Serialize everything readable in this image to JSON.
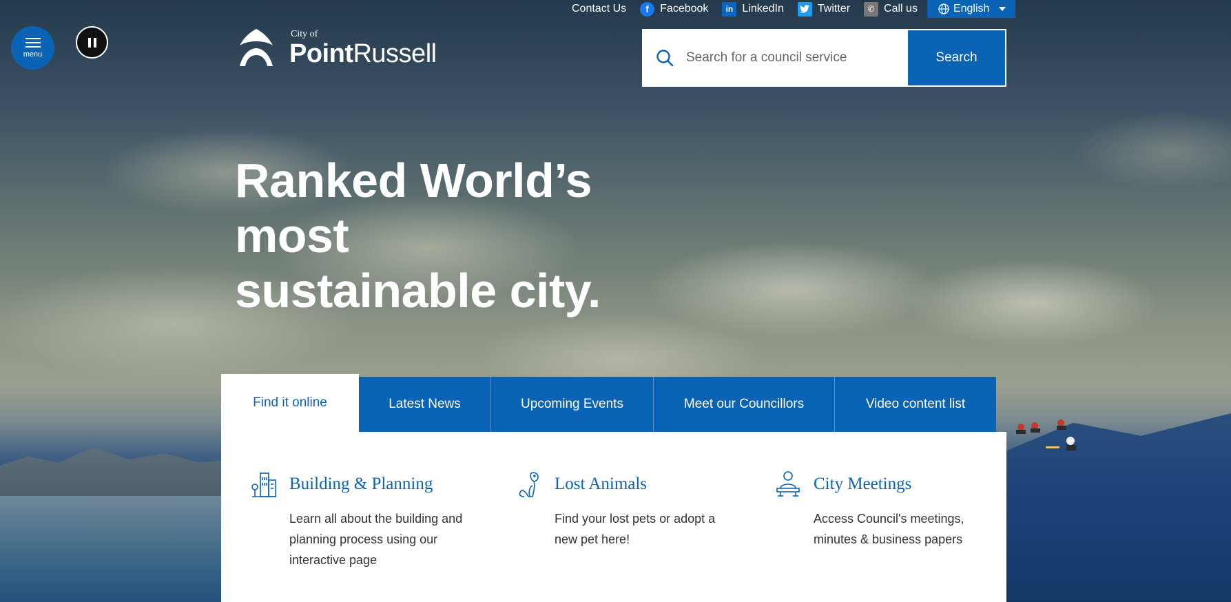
{
  "topbar": {
    "contact": "Contact Us",
    "facebook": "Facebook",
    "linkedin": "LinkedIn",
    "twitter": "Twitter",
    "call": "Call us",
    "language": "English"
  },
  "menu": {
    "label": "menu"
  },
  "logo": {
    "small": "City of",
    "name_bold": "Point",
    "name_regular": "Russell"
  },
  "search": {
    "placeholder": "Search for a council service",
    "button": "Search"
  },
  "hero": {
    "line1": "Ranked World’s most",
    "line2": "sustainable city."
  },
  "tabs": [
    {
      "label": "Find it online"
    },
    {
      "label": "Latest News"
    },
    {
      "label": "Upcoming Events"
    },
    {
      "label": "Meet our Councillors"
    },
    {
      "label": "Video content list"
    }
  ],
  "cards": [
    {
      "title": "Building & Planning",
      "desc": "Learn all about the building and planning process using our interactive page",
      "icon": "building-icon"
    },
    {
      "title": "Lost Animals",
      "desc": "Find your lost pets or adopt a new pet here!",
      "icon": "dog-icon"
    },
    {
      "title": "City Meetings",
      "desc": "Access Council's meetings, minutes & business papers",
      "icon": "meeting-icon"
    }
  ],
  "colors": {
    "brand": "#0a63b5",
    "text": "#333333",
    "white": "#ffffff"
  }
}
